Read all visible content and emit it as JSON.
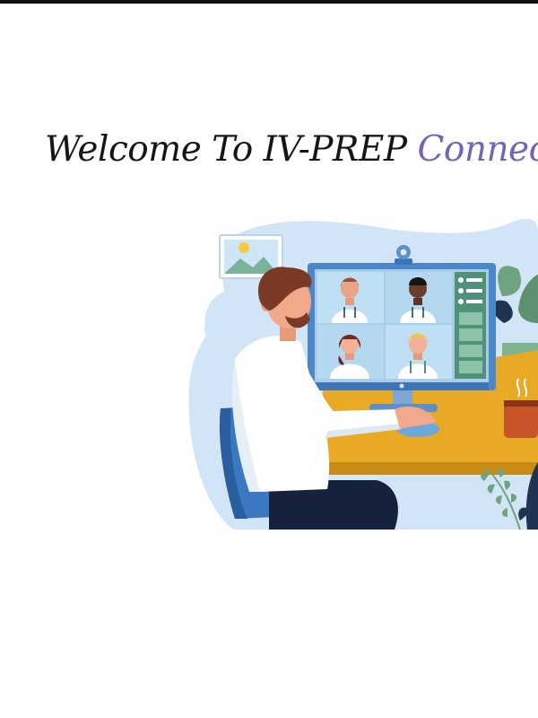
{
  "heading": {
    "prefix": "Welcome To IV-PREP",
    "brand": "Connect"
  },
  "illustration": {
    "subject": "telehealth-video-call",
    "colors": {
      "brand_purple": "#6e66b8",
      "blob": "#cfe3f5",
      "chair": "#3a78c2",
      "desk": "#e8a925",
      "monitor_frame": "#4a86c8",
      "screen": "#a9cde9",
      "skin": "#f0a98a",
      "hair": "#7a3a26",
      "shirt": "#ffffff",
      "trousers": "#16213b",
      "mug": "#c8552a",
      "plant_dark": "#1f3452",
      "plant_light": "#6fa37f"
    },
    "icons": [
      "photo-frame-icon",
      "webcam-icon",
      "coffee-mug-icon",
      "plant-icon"
    ]
  }
}
